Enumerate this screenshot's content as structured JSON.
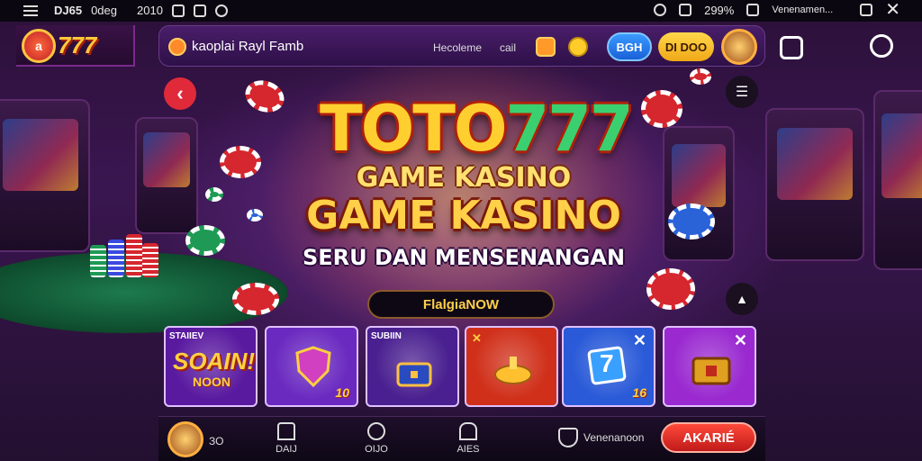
{
  "status_bar": {
    "time": "DJ65",
    "label_a": "0deg",
    "label_b": "2010",
    "battery": "299%",
    "network_label": "Venenamen..."
  },
  "app": {
    "logo_badge": "a",
    "logo_text": "777",
    "title": "kaoplai Rayl Famb",
    "link_1": "Hecoleme",
    "link_2": "cail",
    "button_blue": "ВGH",
    "button_yellow": "DI DOO"
  },
  "hero": {
    "logo_prefix": "TOTO",
    "logo_number": "777",
    "line_1": "GAME KASINO",
    "line_2": "GAME KASINO",
    "tagline": "SERU DAN MENSENANGAN",
    "cta_label": "FlalgiaNOW"
  },
  "tiles": [
    {
      "label": "STAIIEV",
      "big": "SOAIN!",
      "small": "NOON",
      "badge": "",
      "bg": "#5a1aa0"
    },
    {
      "label": "",
      "big": "",
      "small": "",
      "badge": "10",
      "bg": "#6a2ac0"
    },
    {
      "label": "SUBIIN",
      "big": "",
      "small": "",
      "badge": "",
      "bg": "#4a2090"
    },
    {
      "label": "",
      "big": "",
      "small": "",
      "badge": "",
      "bg": "#d0301a"
    },
    {
      "label": "",
      "big": "7",
      "small": "",
      "badge": "16",
      "bg": "#2a5ad8"
    },
    {
      "label": "",
      "big": "",
      "small": "",
      "badge": "",
      "bg": "#9a2ad0"
    }
  ],
  "bottom_nav": {
    "avatar_label": "ЗО",
    "items": [
      {
        "label": "DAIJ"
      },
      {
        "label": "OIJO"
      },
      {
        "label": "AIES"
      }
    ],
    "shield_label": "Venenanoon",
    "action_label": "AKARIÉ"
  }
}
